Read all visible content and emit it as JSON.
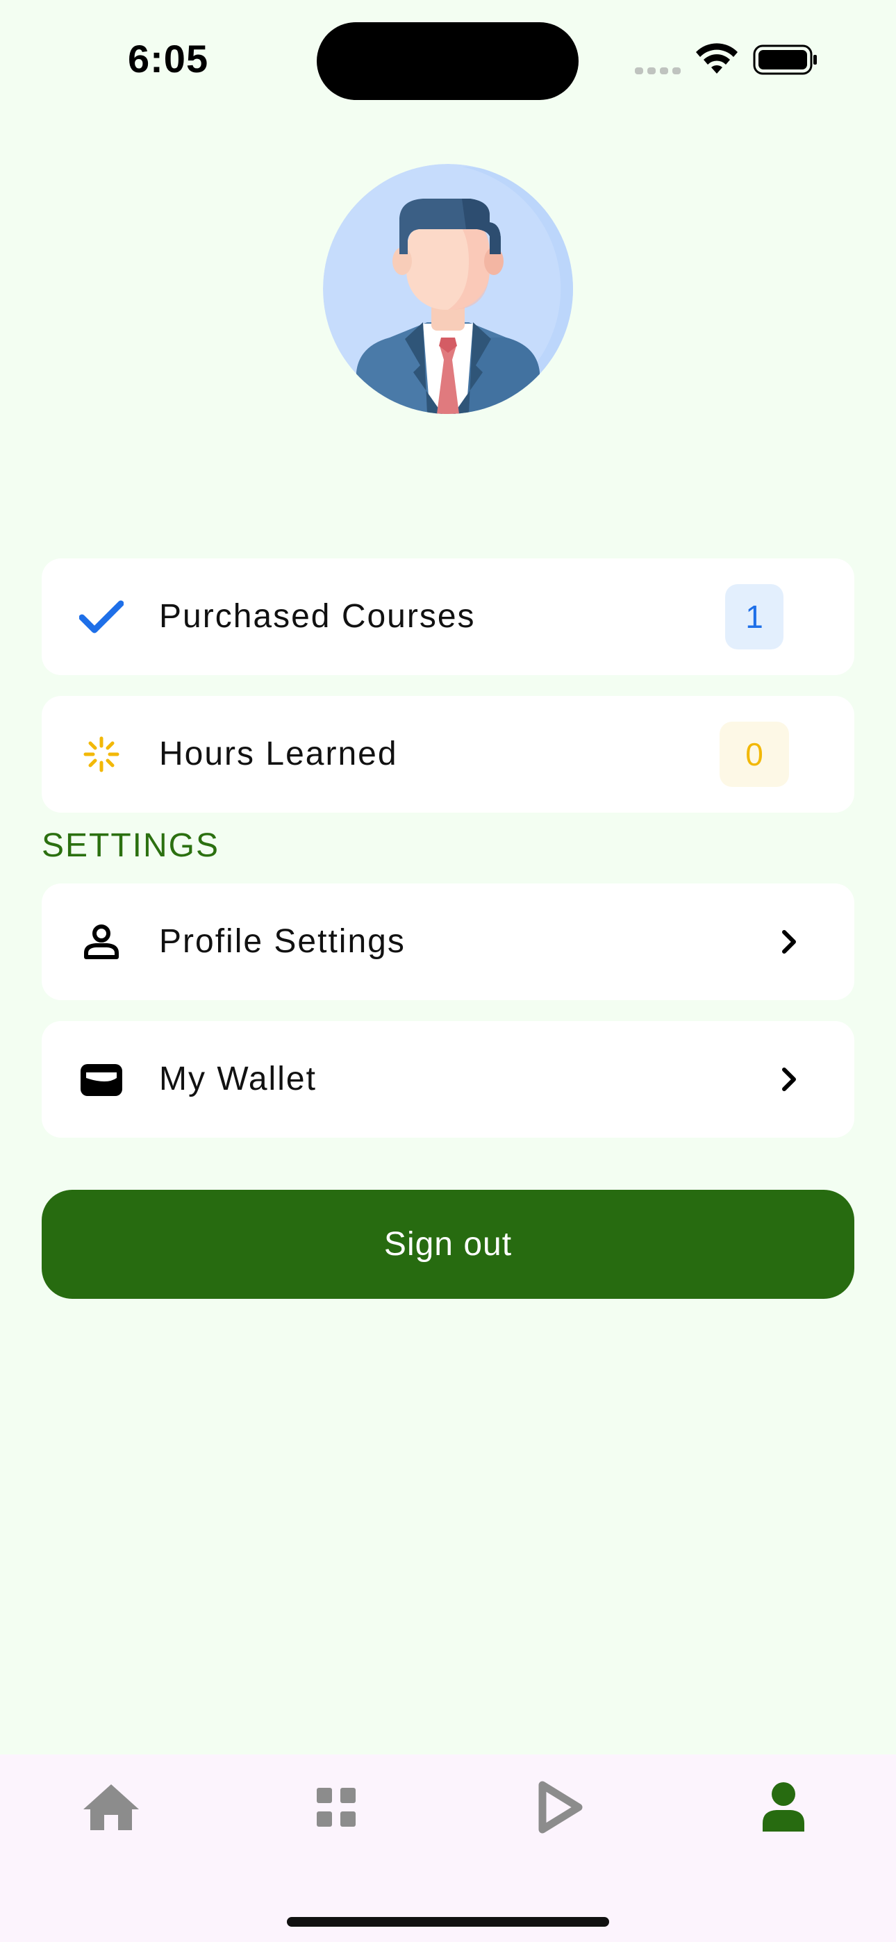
{
  "status_bar": {
    "time": "6:05"
  },
  "stats": [
    {
      "label": "Purchased Courses",
      "value": "1",
      "icon": "checkmark-icon",
      "color": "#1e6fe8"
    },
    {
      "label": "Hours Learned",
      "value": "0",
      "icon": "loading-spinner-icon",
      "color": "#f2b808"
    }
  ],
  "settings": {
    "title": "SETTINGS",
    "items": [
      {
        "label": "Profile Settings",
        "icon": "person-icon"
      },
      {
        "label": "My Wallet",
        "icon": "wallet-icon"
      }
    ]
  },
  "actions": {
    "sign_out": "Sign out"
  },
  "tab_bar": {
    "tabs": [
      {
        "icon": "home-icon",
        "active": false
      },
      {
        "icon": "grid-icon",
        "active": false
      },
      {
        "icon": "play-icon",
        "active": false
      },
      {
        "icon": "person-icon",
        "active": true
      }
    ],
    "active_color": "#276b10",
    "inactive_color": "#8c8c8c"
  },
  "colors": {
    "background": "#f3fef2",
    "accent": "#276b10"
  }
}
